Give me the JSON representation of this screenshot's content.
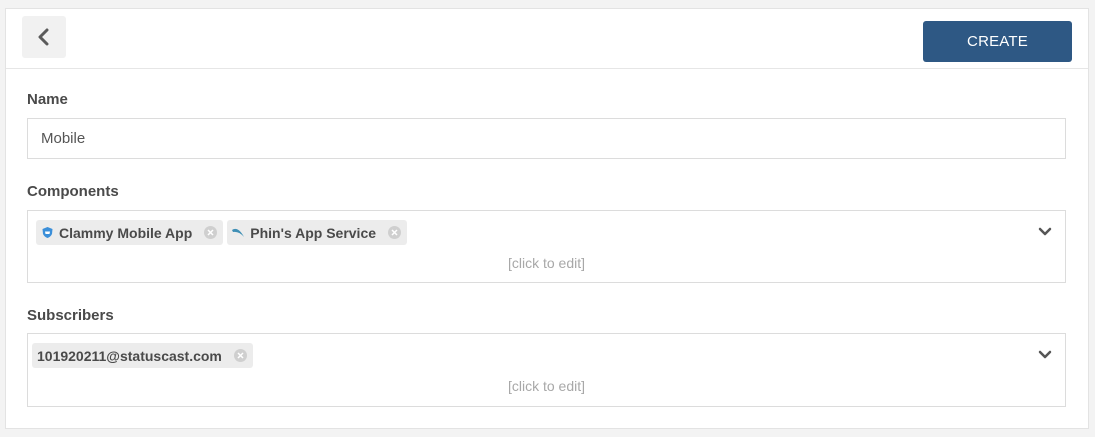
{
  "toolbar": {
    "back_icon": "chevron-left-icon",
    "create_label": "CREATE"
  },
  "name": {
    "label": "Name",
    "value": "Mobile"
  },
  "components": {
    "label": "Components",
    "tags": [
      {
        "label": "Clammy Mobile App",
        "icon": "shield-logo-icon"
      },
      {
        "label": "Phin's App Service",
        "icon": "fin-logo-icon"
      }
    ],
    "placeholder": "[click to edit]"
  },
  "subscribers": {
    "label": "Subscribers",
    "tags": [
      {
        "label": "101920211@statuscast.com"
      }
    ],
    "placeholder": "[click to edit]"
  },
  "colors": {
    "primary": "#2e5884",
    "tag_bg": "#ececec",
    "placeholder": "#a8a8a8"
  }
}
